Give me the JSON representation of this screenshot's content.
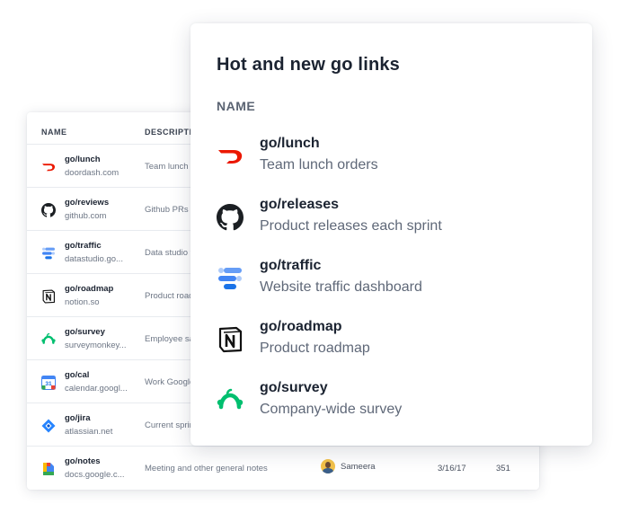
{
  "back_table": {
    "columns": [
      "NAME",
      "DESCRIPTIO"
    ],
    "rows": [
      {
        "icon": "doordash-icon",
        "title": "go/lunch",
        "domain": "doordash.com",
        "description": "Team lunch o"
      },
      {
        "icon": "github-icon",
        "title": "go/reviews",
        "domain": "github.com",
        "description": "Github PRs t"
      },
      {
        "icon": "data-studio-icon",
        "title": "go/traffic",
        "domain": "datastudio.go...",
        "description": "Data studio t"
      },
      {
        "icon": "notion-icon",
        "title": "go/roadmap",
        "domain": "notion.so",
        "description": "Product road"
      },
      {
        "icon": "surveymonkey-icon",
        "title": "go/survey",
        "domain": "surveymonkey...",
        "description": "Employee sa"
      },
      {
        "icon": "google-calendar-icon",
        "title": "go/cal",
        "domain": "calendar.googl...",
        "description": "Work Google"
      },
      {
        "icon": "jira-icon",
        "title": "go/jira",
        "domain": "atlassian.net",
        "description": "Current sprin"
      },
      {
        "icon": "google-docs-icon",
        "title": "go/notes",
        "domain": "docs.google.c...",
        "description": "Meeting and other general notes",
        "owner": "Sameera",
        "date": "3/16/17",
        "count": "351"
      }
    ]
  },
  "front_card": {
    "title": "Hot and new go links",
    "column": "NAME",
    "links": [
      {
        "icon": "doordash-icon",
        "title": "go/lunch",
        "description": "Team lunch orders"
      },
      {
        "icon": "github-icon",
        "title": "go/releases",
        "description": "Product releases each sprint"
      },
      {
        "icon": "data-studio-icon",
        "title": "go/traffic",
        "description": "Website traffic dashboard"
      },
      {
        "icon": "notion-icon",
        "title": "go/roadmap",
        "description": "Product roadmap"
      },
      {
        "icon": "surveymonkey-icon",
        "title": "go/survey",
        "description": "Company-wide survey"
      }
    ]
  },
  "colors": {
    "doordash": "#eb1700",
    "surveymonkey": "#00bf6f",
    "data_studio_blue": "#4285f4",
    "jira_blue": "#2684ff"
  }
}
